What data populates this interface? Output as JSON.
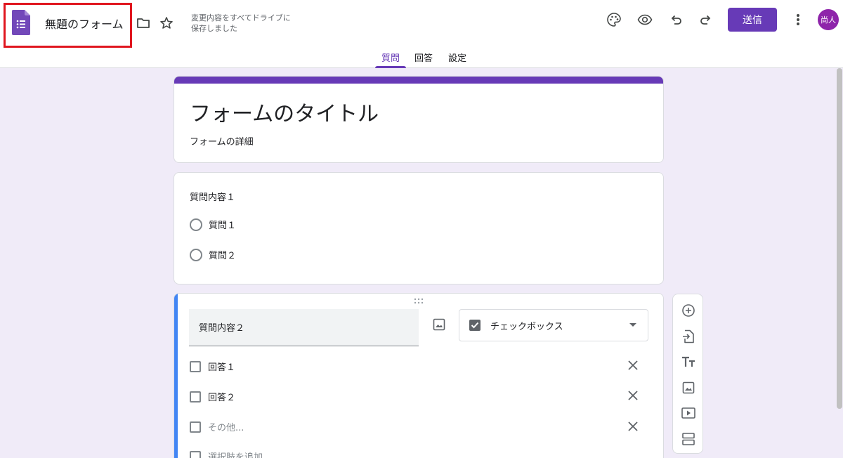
{
  "header": {
    "doc_title": "無題のフォーム",
    "save_status_line1": "変更内容をすべてドライブに",
    "save_status_line2": "保存しました",
    "send_label": "送信",
    "avatar_initials": "尚人",
    "icons": [
      "forms-logo-icon",
      "folder-icon",
      "star-icon",
      "palette-icon",
      "eye-icon",
      "undo-icon",
      "redo-icon",
      "more-vert-icon"
    ]
  },
  "tabs": [
    {
      "label": "質問",
      "active": true
    },
    {
      "label": "回答",
      "active": false
    },
    {
      "label": "設定",
      "active": false
    }
  ],
  "form": {
    "title": "フォームのタイトル",
    "description": "フォームの詳細"
  },
  "questions": [
    {
      "title": "質問内容１",
      "type": "radio",
      "options": [
        "質問１",
        "質問２"
      ]
    },
    {
      "title": "質問内容２",
      "type_label": "チェックボックス",
      "options": [
        "回答１",
        "回答２"
      ],
      "other_option": "その他...",
      "add_option": "選択肢を追加"
    }
  ],
  "side_toolbar": [
    "add-question-icon",
    "import-questions-icon",
    "add-title-icon",
    "add-image-icon",
    "add-video-icon",
    "add-section-icon"
  ],
  "colors": {
    "brand": "#673ab7",
    "background": "#f0ebf8",
    "active_question_accent": "#4285f4",
    "highlight": "#e0161f"
  }
}
